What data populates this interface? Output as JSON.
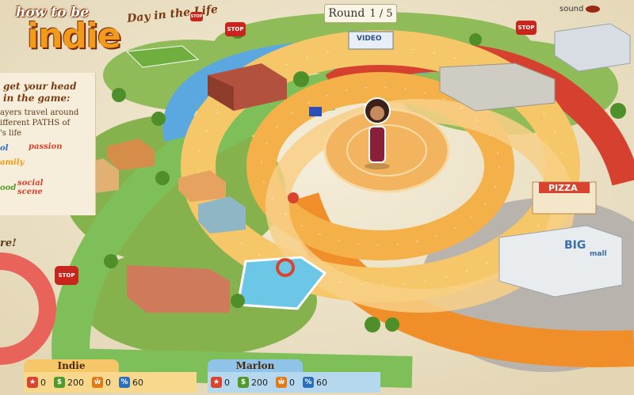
{
  "header": {
    "logo_line1": "how to be",
    "logo_line2": "indie",
    "subtitle": "Day in the Life",
    "round_label": "Round",
    "round_value": "1 / 5",
    "sound_label": "sound"
  },
  "info_panel": {
    "heading_line1": "get your head",
    "heading_line2": "in the game:",
    "body_line1": "ayers travel around",
    "body_line2": "ifferent PATHS of",
    "body_line3": "'s life",
    "words": [
      "ol",
      "passion",
      "amily",
      "ood",
      "social scene"
    ]
  },
  "here_label": "re!",
  "signs": [
    "STOP",
    "STOP",
    "STOP",
    "STOP"
  ],
  "buildings": {
    "video": "VIDEO",
    "pizza": "PIZZA",
    "mall_big": "BIG",
    "mall_small": "mall"
  },
  "players": [
    {
      "name": "Indie",
      "stats": {
        "star": "0",
        "money": "200",
        "people": "0",
        "percent": "60"
      }
    },
    {
      "name": "Marlon",
      "stats": {
        "star": "0",
        "money": "200",
        "people": "0",
        "percent": "60"
      }
    }
  ],
  "colors": {
    "path_green": "#8fc56a",
    "path_blue": "#5aa8df",
    "path_red": "#d6402f",
    "path_orange": "#f2a33a",
    "path_yellow": "#f6c768",
    "grass": "#7fb04a",
    "parchment": "#efe6cf"
  }
}
